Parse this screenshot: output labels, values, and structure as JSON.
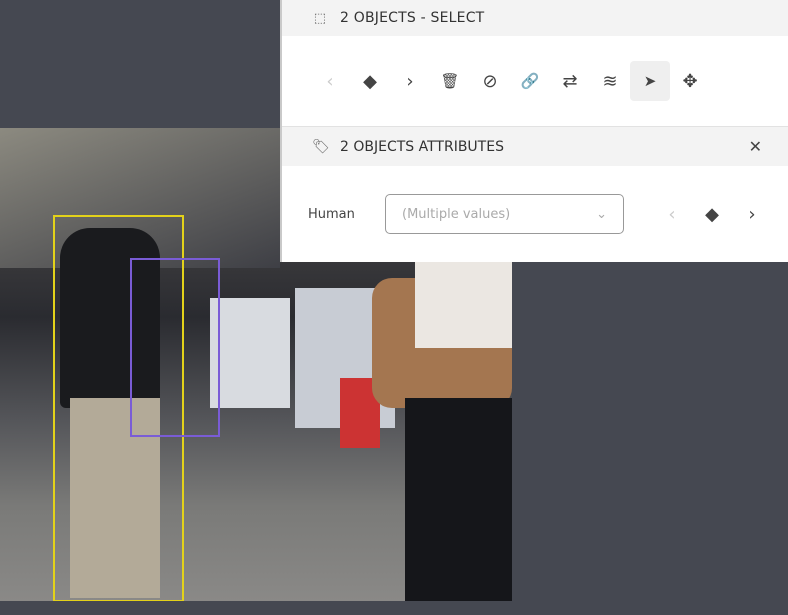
{
  "select_panel": {
    "title": "2 OBJECTS - SELECT"
  },
  "toolbar": {
    "prev": "‹",
    "keyframe": "◆",
    "next": "›",
    "delete": "🗑",
    "hide": "⊘",
    "link": "🔗",
    "swap": "⇄",
    "layers": "≋",
    "select": "➤",
    "move": "✥"
  },
  "attributes": {
    "title": "2 OBJECTS ATTRIBUTES",
    "close": "✕",
    "label": "Human",
    "select_placeholder": "(Multiple values)",
    "chevron": "⌄",
    "prev": "‹",
    "keyframe": "◆",
    "next": "›"
  },
  "colors": {
    "box_yellow": "#e3d21a",
    "box_purple": "#7a5cd6",
    "background": "#454851"
  }
}
